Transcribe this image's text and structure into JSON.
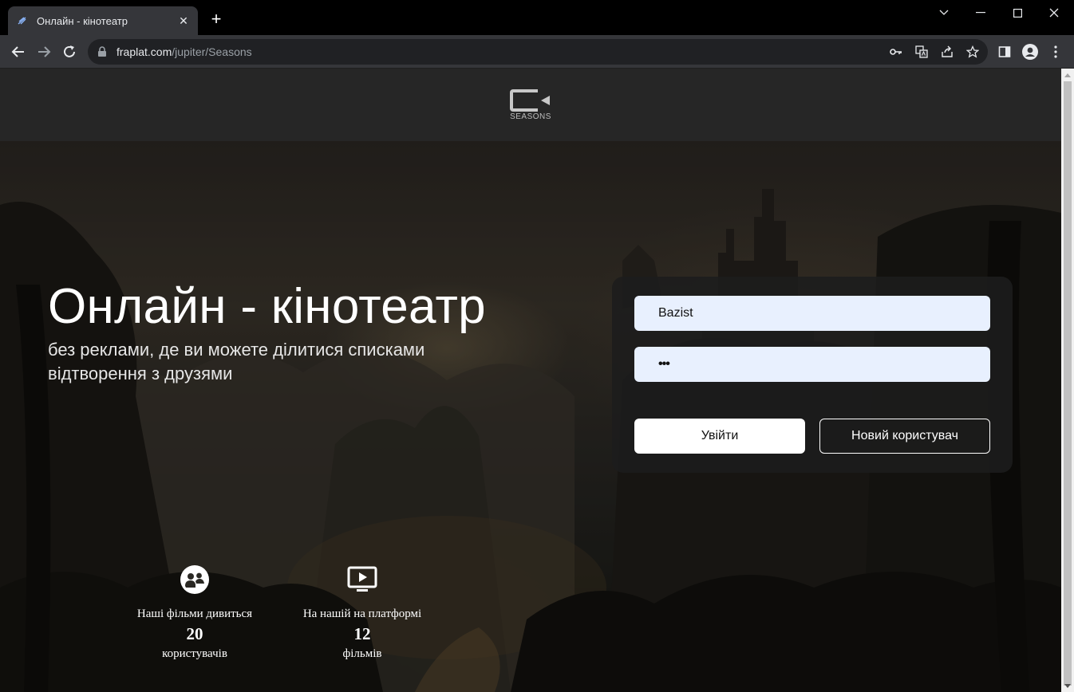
{
  "browser": {
    "tab_title": "Онлайн - кінотеатр",
    "url_host": "fraplat.com",
    "url_path": "/jupiter/Seasons"
  },
  "header": {
    "logo_text": "SEASONS"
  },
  "hero": {
    "headline": "Онлайн - кінотеатр",
    "subline": "без реклами, де ви можете ділитися списками відтворення з друзями"
  },
  "login": {
    "username_value": "Bazist",
    "password_value": "•••",
    "login_label": "Увійти",
    "new_user_label": "Новий користувач"
  },
  "stats": [
    {
      "line1": "Наші фільми дивиться",
      "number": "20",
      "line2": "користувачів",
      "icon": "users-icon"
    },
    {
      "line1": "На нашій на платформі",
      "number": "12",
      "line2": "фільмів",
      "icon": "play-screen-icon"
    }
  ],
  "colors": {
    "field_bg": "#e8f0fe",
    "panel_bg": "#1c1c1c",
    "header_bg": "#262626"
  }
}
